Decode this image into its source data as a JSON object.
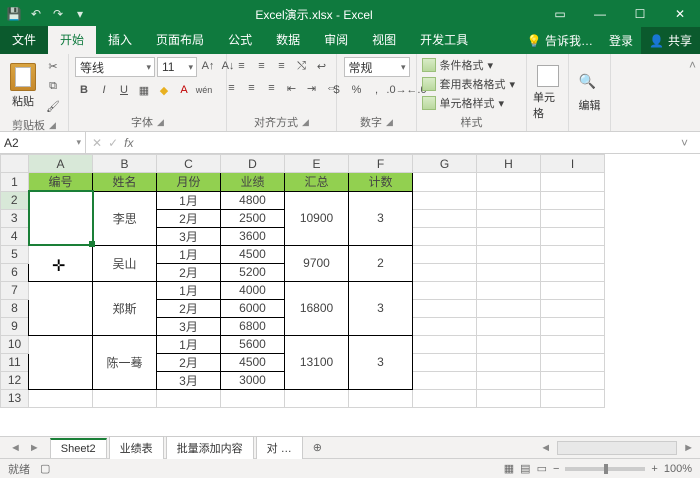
{
  "title": "Excel演示.xlsx - Excel",
  "tabs": {
    "file": "文件",
    "home": "开始",
    "insert": "插入",
    "layout": "页面布局",
    "formulas": "公式",
    "data": "数据",
    "review": "审阅",
    "view": "视图",
    "dev": "开发工具",
    "tellme": "告诉我…",
    "signin": "登录",
    "share": "共享"
  },
  "ribbon": {
    "clipboard": {
      "paste": "粘贴",
      "label": "剪贴板"
    },
    "font": {
      "name": "等线",
      "size": "11",
      "label": "字体"
    },
    "align": {
      "label": "对齐方式"
    },
    "number": {
      "format": "常规",
      "label": "数字"
    },
    "styles": {
      "cond": "条件格式",
      "table": "套用表格格式",
      "cell": "单元格样式",
      "label": "样式"
    },
    "cells": {
      "label": "单元格"
    },
    "editing": {
      "label": "编辑"
    }
  },
  "namebox": "A2",
  "cols": [
    "A",
    "B",
    "C",
    "D",
    "E",
    "F",
    "G",
    "H",
    "I"
  ],
  "rows": [
    "1",
    "2",
    "3",
    "4",
    "5",
    "6",
    "7",
    "8",
    "9",
    "10",
    "11",
    "12",
    "13"
  ],
  "headers": {
    "A": "编号",
    "B": "姓名",
    "C": "月份",
    "D": "业绩",
    "E": "汇总",
    "F": "计数"
  },
  "d": {
    "name1": "李思",
    "name2": "吴山",
    "name3": "郑斯",
    "name4": "陈一蓦",
    "m1": "1月",
    "m2": "2月",
    "m3": "3月",
    "r2d": "4800",
    "r3d": "2500",
    "r4d": "3600",
    "r5d": "4500",
    "r6d": "5200",
    "r7d": "4000",
    "r8d": "6000",
    "r9d": "6800",
    "r10d": "5600",
    "r11d": "4500",
    "r12d": "3000",
    "e1": "10900",
    "e2": "9700",
    "e3": "16800",
    "e4": "13100",
    "f1": "3",
    "f2": "2",
    "f3": "3",
    "f4": "3"
  },
  "sheets": {
    "s1": "Sheet2",
    "s2": "业绩表",
    "s3": "批量添加内容",
    "s4": "对 …"
  },
  "status": {
    "ready": "就绪",
    "zoom": "100%"
  }
}
